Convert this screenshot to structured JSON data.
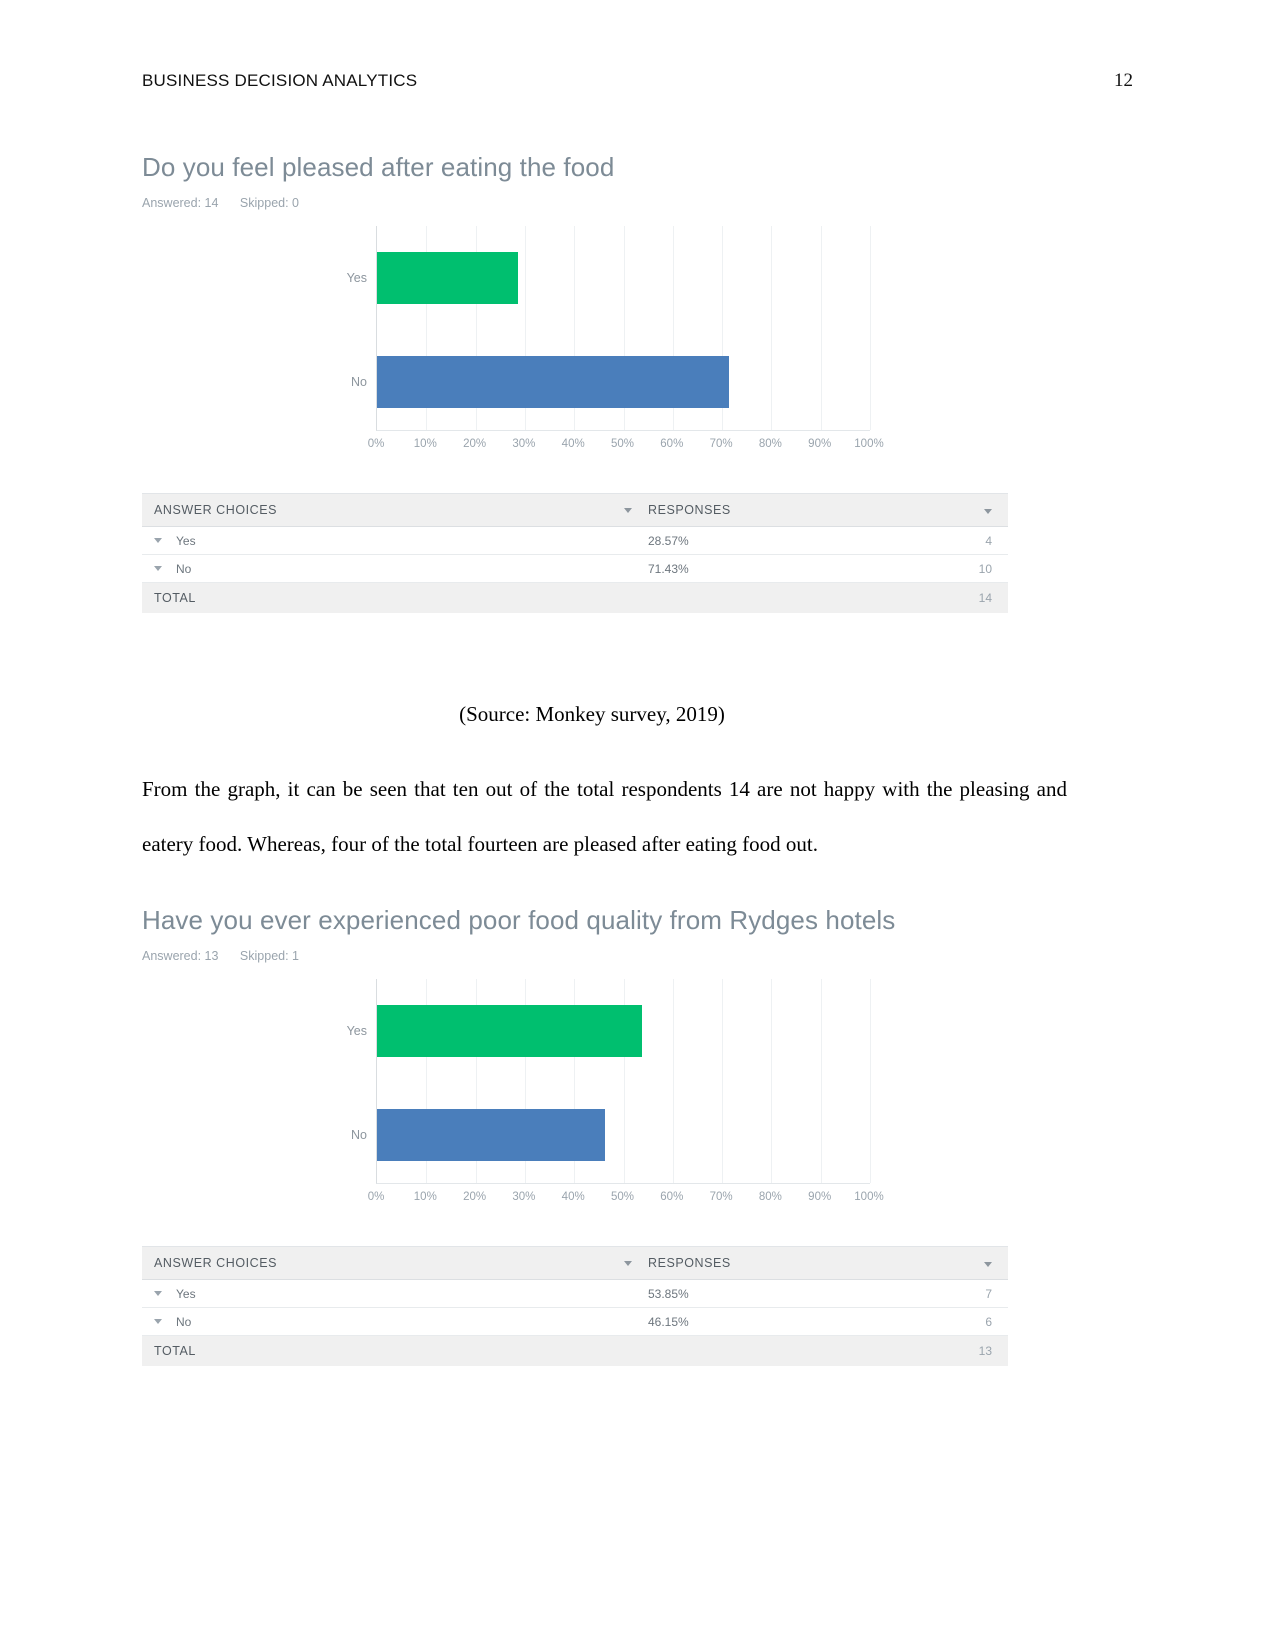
{
  "header": {
    "title": "BUSINESS DECISION ANALYTICS",
    "page_number": "12"
  },
  "colors": {
    "yes_bar": "#00bf6f",
    "no_bar": "#4a7ebb",
    "title_gray": "#7d8b96",
    "meta_gray": "#9aa4ad",
    "table_header_bg": "#f0f0f0"
  },
  "survey1": {
    "title": "Do you feel pleased after eating the food",
    "answered_label": "Answered: 14",
    "skipped_label": "Skipped: 0",
    "table": {
      "col_choices": "ANSWER CHOICES",
      "col_responses": "RESPONSES",
      "rows": [
        {
          "choice": "Yes",
          "percent": "28.57%",
          "count": "4"
        },
        {
          "choice": "No",
          "percent": "71.43%",
          "count": "10"
        }
      ],
      "total_label": "TOTAL",
      "total_count": "14"
    },
    "chart_data": {
      "type": "bar",
      "orientation": "horizontal",
      "title": "Do you feel pleased after eating the food",
      "subtitle": "Answered: 14    Skipped: 0",
      "categories": [
        "Yes",
        "No"
      ],
      "values": [
        28.57,
        71.43
      ],
      "counts": [
        4,
        10
      ],
      "colors": [
        "#00bf6f",
        "#4a7ebb"
      ],
      "xlabel": "",
      "ylabel": "",
      "xlim": [
        0,
        100
      ],
      "xticks": [
        0,
        10,
        20,
        30,
        40,
        50,
        60,
        70,
        80,
        90,
        100
      ],
      "xticklabels": [
        "0%",
        "10%",
        "20%",
        "30%",
        "40%",
        "50%",
        "60%",
        "70%",
        "80%",
        "90%",
        "100%"
      ],
      "grid": true,
      "legend": "none"
    }
  },
  "source_caption": "(Source: Monkey survey, 2019)",
  "paragraph": "From the graph, it can be seen that ten out of the total respondents 14 are not happy with the pleasing and eatery food. Whereas, four of the total fourteen are pleased after eating food out.",
  "survey2": {
    "title": "Have you ever experienced poor food quality from Rydges hotels",
    "answered_label": "Answered: 13",
    "skipped_label": "Skipped: 1",
    "table": {
      "col_choices": "ANSWER CHOICES",
      "col_responses": "RESPONSES",
      "rows": [
        {
          "choice": "Yes",
          "percent": "53.85%",
          "count": "7"
        },
        {
          "choice": "No",
          "percent": "46.15%",
          "count": "6"
        }
      ],
      "total_label": "TOTAL",
      "total_count": "13"
    },
    "chart_data": {
      "type": "bar",
      "orientation": "horizontal",
      "title": "Have you ever experienced poor food quality from Rydges hotels",
      "subtitle": "Answered: 13    Skipped: 1",
      "categories": [
        "Yes",
        "No"
      ],
      "values": [
        53.85,
        46.15
      ],
      "counts": [
        7,
        6
      ],
      "colors": [
        "#00bf6f",
        "#4a7ebb"
      ],
      "xlabel": "",
      "ylabel": "",
      "xlim": [
        0,
        100
      ],
      "xticks": [
        0,
        10,
        20,
        30,
        40,
        50,
        60,
        70,
        80,
        90,
        100
      ],
      "xticklabels": [
        "0%",
        "10%",
        "20%",
        "30%",
        "40%",
        "50%",
        "60%",
        "70%",
        "80%",
        "90%",
        "100%"
      ],
      "grid": true,
      "legend": "none"
    }
  }
}
